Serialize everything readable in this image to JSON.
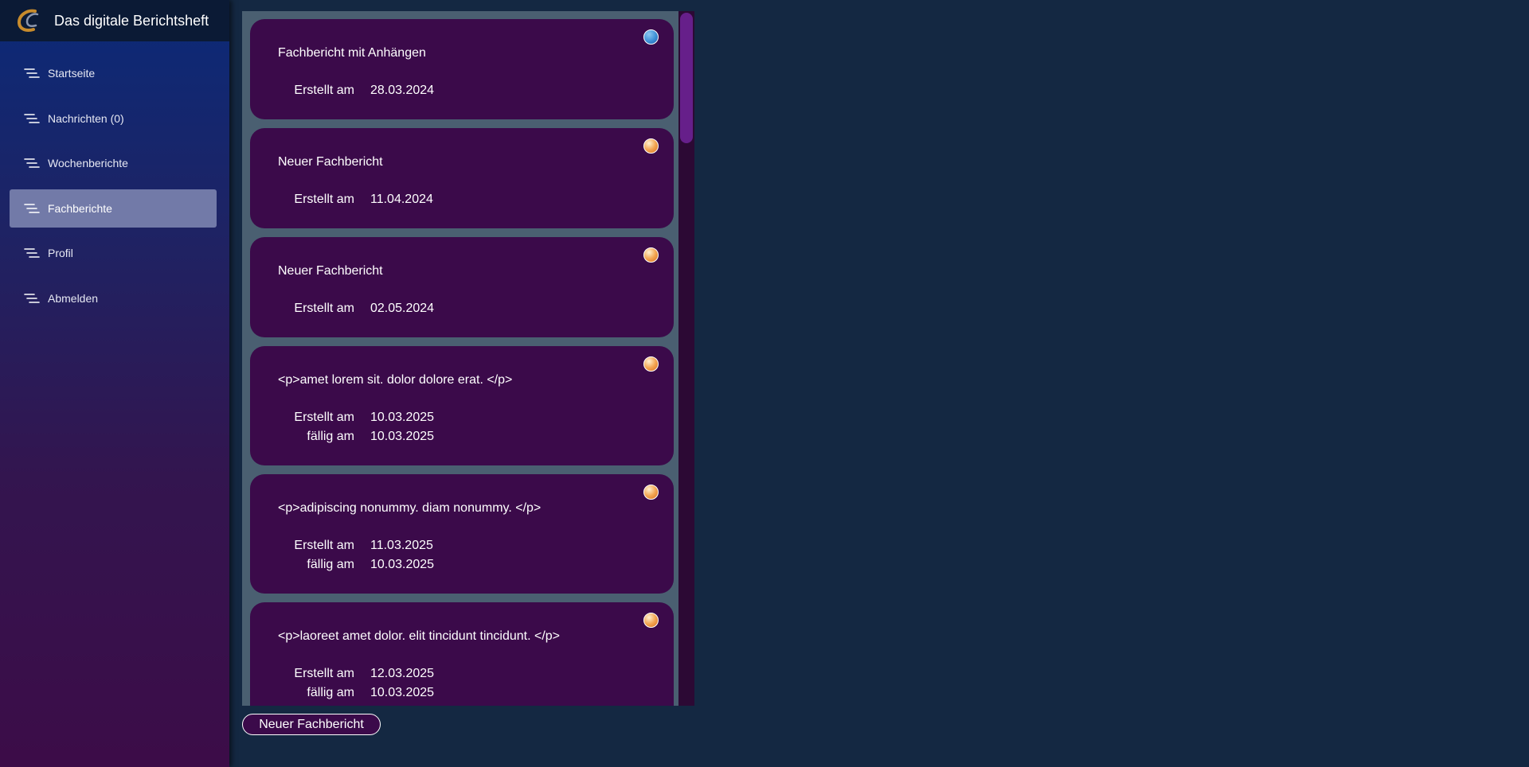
{
  "app": {
    "title": "Das digitale Berichtsheft"
  },
  "sidebar": {
    "items": [
      {
        "label": "Startseite",
        "icon": "menu-lines-icon",
        "active": false
      },
      {
        "label": "Nachrichten (0)",
        "icon": "menu-lines-icon",
        "active": false
      },
      {
        "label": "Wochenberichte",
        "icon": "menu-lines-icon",
        "active": false
      },
      {
        "label": "Fachberichte",
        "icon": "menu-lines-icon",
        "active": true
      },
      {
        "label": "Profil",
        "icon": "menu-lines-icon",
        "active": false
      },
      {
        "label": "Abmelden",
        "icon": "menu-lines-icon",
        "active": false
      }
    ]
  },
  "reports": [
    {
      "title": "Fachbericht mit Anhängen",
      "created_label": "Erstellt am",
      "created": "28.03.2024",
      "status_color": "#3c8fd6"
    },
    {
      "title": "Neuer Fachbericht",
      "created_label": "Erstellt am",
      "created": "11.04.2024",
      "status_color": "#f3a653"
    },
    {
      "title": "Neuer Fachbericht",
      "created_label": "Erstellt am",
      "created": "02.05.2024",
      "status_color": "#f3a653"
    },
    {
      "title": "<p>amet lorem sit. dolor dolore erat. </p>",
      "created_label": "Erstellt am",
      "created": "10.03.2025",
      "due_label": "fällig am",
      "due": "10.03.2025",
      "status_color": "#f3a653"
    },
    {
      "title": "<p>adipiscing nonummy. diam nonummy. </p>",
      "created_label": "Erstellt am",
      "created": "11.03.2025",
      "due_label": "fällig am",
      "due": "10.03.2025",
      "status_color": "#f3a653"
    },
    {
      "title": "<p>laoreet amet dolor. elit tincidunt tincidunt. </p>",
      "created_label": "Erstellt am",
      "created": "12.03.2025",
      "due_label": "fällig am",
      "due": "10.03.2025",
      "status_color": "#f3a653"
    }
  ],
  "actions": {
    "new_report_label": "Neuer Fachbericht"
  },
  "colors": {
    "sidebar_top": "#0b2a78",
    "sidebar_bottom": "#3c0c48",
    "active_nav": "#727aa8",
    "card": "#3b0a4a",
    "background": "#142842",
    "status_blue": "#3c8fd6",
    "status_orange": "#f3a653"
  }
}
